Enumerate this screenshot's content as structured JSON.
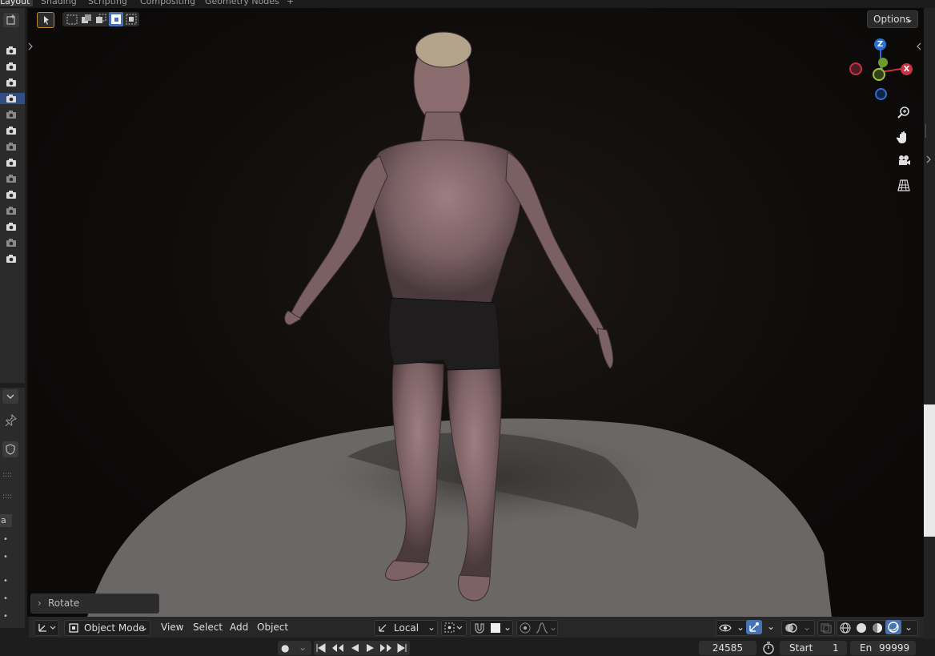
{
  "workspace_tabs": [
    "Layout",
    "Shading",
    "Scripting",
    "Compositing",
    "Geometry Nodes",
    "+"
  ],
  "viewport": {
    "options_label": "Options",
    "gizmo": {
      "z": "Z",
      "x": "X"
    },
    "last_operator": "Rotate"
  },
  "header": {
    "mode": "Object Mode",
    "menus": [
      "View",
      "Select",
      "Add",
      "Object"
    ],
    "transform_orientation": "Local"
  },
  "timeline": {
    "current_frame": "24585",
    "start_label": "Start",
    "start_value": "1",
    "end_label": "En",
    "end_value": "99999"
  },
  "colors": {
    "axis_x": "#c8333f",
    "axis_y": "#6c9c2a",
    "axis_z": "#2d6fd1",
    "selection": "#334d80",
    "active_button": "#4772b3"
  }
}
